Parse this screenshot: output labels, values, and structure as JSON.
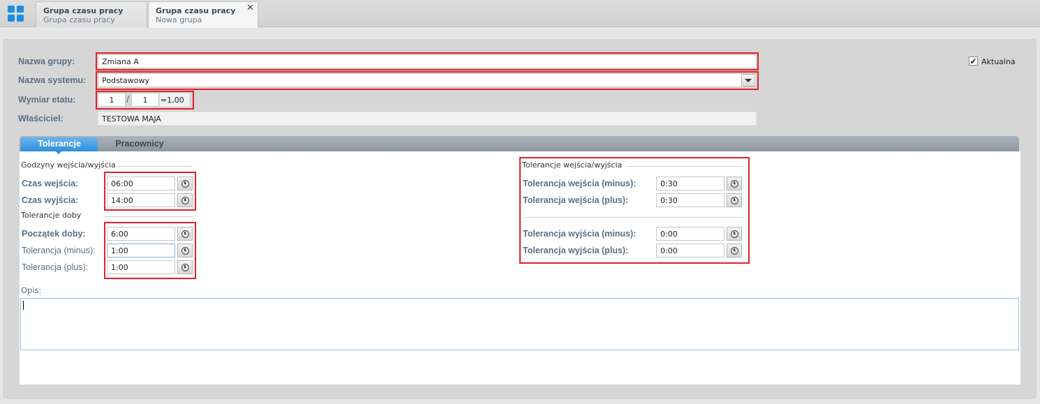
{
  "top_tabs": [
    {
      "title": "Grupa czasu pracy",
      "subtitle": "Grupa czasu pracy"
    },
    {
      "title": "Grupa czasu pracy",
      "subtitle": "Nowa grupa",
      "close": "✕"
    }
  ],
  "form": {
    "group_name_label": "Nazwa grupy:",
    "group_name_value": "Zmiana A",
    "system_name_label": "Nazwa systemu:",
    "system_name_value": "Podstawowy",
    "fte_label": "Wymiar etatu:",
    "fte_numerator": "1",
    "fte_separator": "/",
    "fte_denominator": "1",
    "fte_result": "=1,00",
    "owner_label": "Właściciel:",
    "owner_value": "TESTOWA MAJA",
    "current_label": "Aktualna",
    "current_checked": true
  },
  "inner_tabs": [
    {
      "label": "Tolerancje",
      "active": true
    },
    {
      "label": "Pracownicy",
      "active": false
    }
  ],
  "hours": {
    "section_title": "Godzyny wejścia/wyjścia",
    "entry_label": "Czas wejścia:",
    "entry_value": "06:00",
    "exit_label": "Czas wyjścia:",
    "exit_value": "14:00"
  },
  "day_tolerance": {
    "section_title": "Tolerancje doby",
    "start_label": "Początek doby:",
    "start_value": "6:00",
    "minus_label": "Tolerancja (minus):",
    "minus_value": "1:00",
    "plus_label": "Tolerancja (plus):",
    "plus_value": "1:00"
  },
  "io_tolerance": {
    "section_title": "Tolerancje wejścia/wyjścia",
    "entry_minus_label": "Tolerancja wejścia (minus):",
    "entry_minus_value": "0:30",
    "entry_plus_label": "Tolerancja wejścia (plus):",
    "entry_plus_value": "0:30",
    "exit_minus_label": "Tolerancja wyjścia (minus):",
    "exit_minus_value": "0:00",
    "exit_plus_label": "Tolerancja wyjścia (plus):",
    "exit_plus_value": "0:00"
  },
  "description": {
    "label": "Opis:",
    "value": ""
  },
  "colors": {
    "accent": "#2e8fd9",
    "highlight_border": "#e0202a",
    "label_text": "#5a6f84"
  }
}
